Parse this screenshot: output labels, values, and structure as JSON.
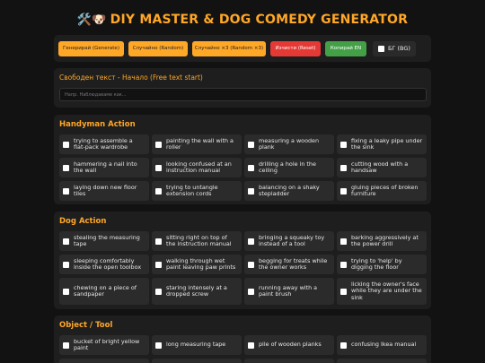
{
  "title": "DIY MASTER & DOG COMEDY GENERATOR",
  "title_icons": "🛠️🐶",
  "toolbar": {
    "generate": "Генерирай (Generate)",
    "random": "Случайно (Random)",
    "random3": "Случайно ×3 (Random ×3)",
    "reset": "Изчисти (Reset)",
    "copy_en": "Копирай EN",
    "bg_label": "БГ (BG)"
  },
  "free_text": {
    "label": "Свободен текст - Начало (Free text start)",
    "placeholder": "Напр. Наблюдаваме как..."
  },
  "sections": [
    {
      "title": "Handyman Action",
      "items": [
        "trying to assemble a flat-pack wardrobe",
        "painting the wall with a roller",
        "measuring a wooden plank",
        "fixing a leaky pipe under the sink",
        "hammering a nail into the wall",
        "looking confused at an instruction manual",
        "drilling a hole in the ceiling",
        "cutting wood with a handsaw",
        "laying down new floor tiles",
        "trying to untangle extension cords",
        "balancing on a shaky stepladder",
        "gluing pieces of broken furniture"
      ]
    },
    {
      "title": "Dog Action",
      "items": [
        "stealing the measuring tape",
        "sitting right on top of the instruction manual",
        "bringing a squeaky toy instead of a tool",
        "barking aggressively at the power drill",
        "sleeping comfortably inside the open toolbox",
        "walking through wet paint leaving paw prints",
        "begging for treats while the owner works",
        "trying to 'help' by digging the floor",
        "chewing on a piece of sandpaper",
        "staring intensely at a dropped screw",
        "running away with a paint brush",
        "licking the owner's face while they are under the sink"
      ]
    },
    {
      "title": "Object / Tool",
      "items": [
        "bucket of bright yellow paint",
        "long measuring tape",
        "pile of wooden planks",
        "confusing Ikea manual"
      ]
    }
  ]
}
